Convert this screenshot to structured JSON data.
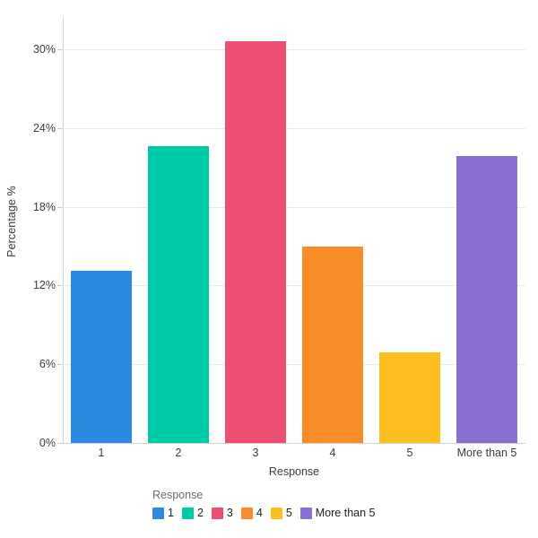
{
  "chart_data": {
    "type": "bar",
    "title": "",
    "subtitle": "",
    "xlabel": "Response",
    "ylabel": "Percentage %",
    "categories": [
      "1",
      "2",
      "3",
      "4",
      "5",
      "More than 5"
    ],
    "values": [
      13.1,
      22.6,
      30.6,
      15.0,
      6.9,
      21.9
    ],
    "series": [
      {
        "name": "Response",
        "values": [
          13.1,
          22.6,
          30.6,
          15.0,
          6.9,
          21.9
        ]
      }
    ],
    "ylim": [
      0,
      32.4
    ],
    "yticks": [
      0,
      6,
      12,
      18,
      24,
      30
    ],
    "ytick_labels": [
      "0%",
      "6%",
      "12%",
      "18%",
      "24%",
      "30%"
    ],
    "grid": true,
    "legend_position": "bottom",
    "legend_title": "Response",
    "colors": [
      "#2a8be0",
      "#00cba8",
      "#eb5070",
      "#f78c28",
      "#fdbe22",
      "#8b6fd0"
    ],
    "legend_entries": [
      {
        "label": "1",
        "color": "#2a8be0"
      },
      {
        "label": "2",
        "color": "#00cba8"
      },
      {
        "label": "3",
        "color": "#eb5070"
      },
      {
        "label": "4",
        "color": "#f78c28"
      },
      {
        "label": "5",
        "color": "#fdbe22"
      },
      {
        "label": "More than 5",
        "color": "#8b6fd0"
      }
    ],
    "axis_color": "#d0d0d0",
    "grid_color": "#eaeaea",
    "background": "#ffffff"
  }
}
